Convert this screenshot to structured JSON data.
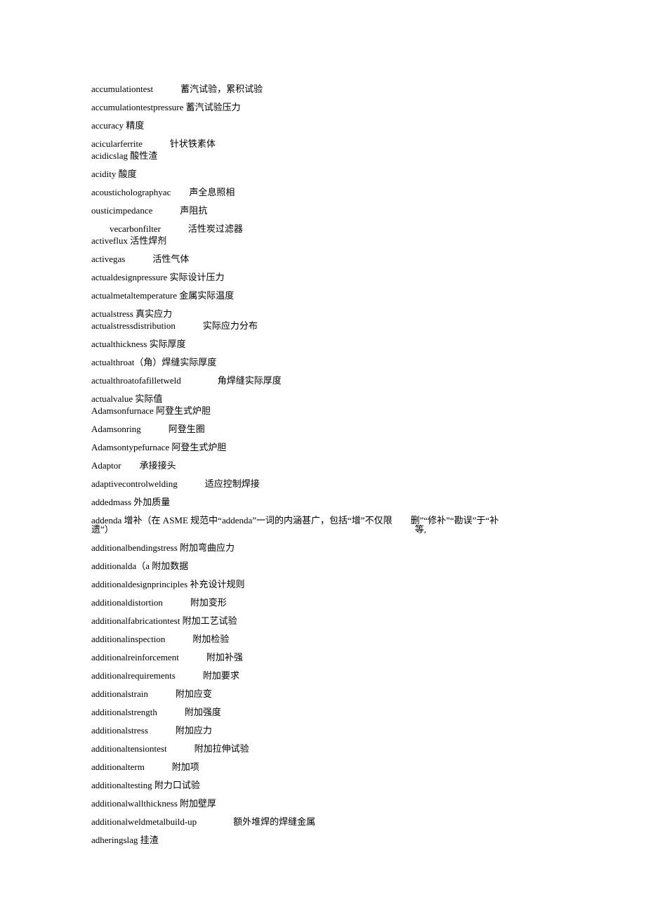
{
  "entries": [
    {
      "text": "accumulationtest   蓄汽试验，累积试验"
    },
    {
      "text": "accumulationtestpressure 蓄汽试验压力"
    },
    {
      "text": "accuracy 精度"
    },
    {
      "text": "acicularferrite   针状铁素体"
    },
    {
      "text": "acidicslag 酸性渣",
      "tight": true
    },
    {
      "text": "acidity 酸度"
    },
    {
      "text": "acousticholographyac  声全息照相"
    },
    {
      "text": "ousticimpedance   声阻抗"
    },
    {
      "text": "  vecarbonfilter   活性炭过滤器"
    },
    {
      "text": "activeflux 活性焊剂",
      "tight": true
    },
    {
      "text": "activegas   活性气体"
    },
    {
      "text": "actualdesignpressure 实际设计压力"
    },
    {
      "text": "actualmetaltemperature 金属实际温度"
    },
    {
      "text": "actualstress 真实应力"
    },
    {
      "text": "actualstressdistribution   实际应力分布",
      "tight": true
    },
    {
      "text": "actualthickness 实际厚度"
    },
    {
      "text": "actualthroat（角）焊缝实际厚度"
    },
    {
      "text": "actualthroatofafilletweld    角焊缝实际厚度"
    },
    {
      "text": "actualvalue 实际值"
    },
    {
      "text": "Adamsonfurnace 阿登生式炉胆",
      "tight": true
    },
    {
      "text": "Adamsonring   阿登生圈"
    },
    {
      "text": "Adamsontypefurnace 阿登生式炉胆"
    },
    {
      "text": "Adaptor  承接接头"
    },
    {
      "text": "adaptivecontrolwelding   适应控制焊接"
    },
    {
      "text": "addedmass 外加质量"
    },
    {
      "text": "addenda 增补（在 ASME 规范中“addenda”一词的内涵甚广，包括“增”不仅限  删”“修补”“勘误”于“补遗”）                                 等,"
    },
    {
      "text": "additionalbendingstress 附加弯曲应力"
    },
    {
      "text": "additionalda（a 附加数据"
    },
    {
      "text": "additionaldesignprinciples 补充设计规则"
    },
    {
      "text": "additionaldistortion   附加变形"
    },
    {
      "text": "additionalfabricationtest 附加工艺试验"
    },
    {
      "text": "additionalinspection   附加检验"
    },
    {
      "text": "additionalreinforcement   附加补强"
    },
    {
      "text": "additionalrequirements   附加要求"
    },
    {
      "text": "additionalstrain   附加应变"
    },
    {
      "text": "additionalstrength   附加强度"
    },
    {
      "text": "additionalstress   附加应力"
    },
    {
      "text": "additionaltensiontest   附加拉伸试验"
    },
    {
      "text": "additionalterm   附加项"
    },
    {
      "text": "additionaltesting 附力口试验"
    },
    {
      "text": "additionalwallthickness 附加壁厚"
    },
    {
      "text": "additionalweldmetalbuild-up    额外堆焊的焊缝金属"
    },
    {
      "text": "adheringslag 挂渣"
    }
  ]
}
